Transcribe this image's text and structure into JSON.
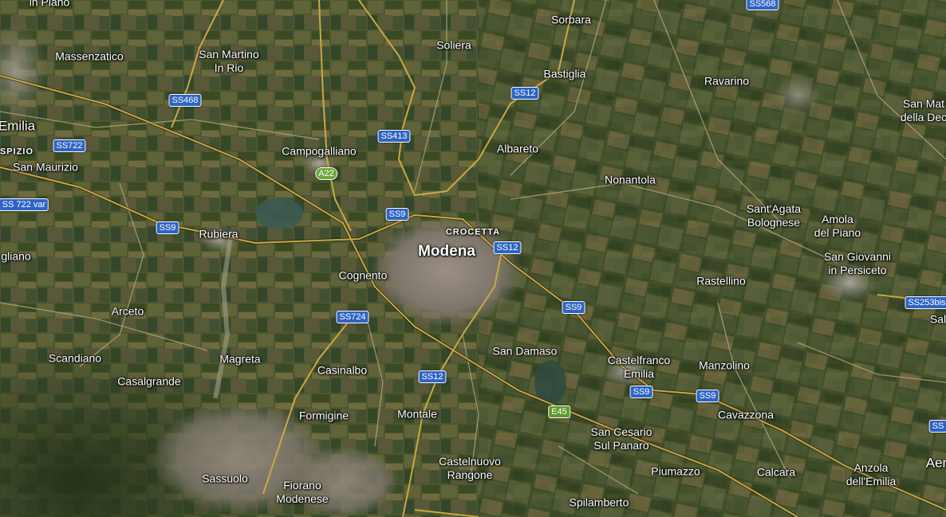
{
  "map": {
    "view": "satellite",
    "colors": {
      "field_light": "#6b6a3e",
      "field_dark": "#2e3f1f",
      "urban": "#8b8377",
      "road_primary": "#c9a844",
      "road_secondary": "#b9ad84",
      "shield_blue": "#2e64c4",
      "shield_green": "#5e9a2c",
      "label": "#ffffff"
    },
    "places": [
      {
        "id": "in-piano",
        "label": "in Piano"
      },
      {
        "id": "sorbara",
        "label": "Sorbara"
      },
      {
        "id": "massenzatico",
        "label": "Massenzatico"
      },
      {
        "id": "san-martino-in-rio",
        "label": "San Martino\nIn Rio"
      },
      {
        "id": "soliera",
        "label": "Soliera"
      },
      {
        "id": "bastiglia",
        "label": "Bastiglia"
      },
      {
        "id": "ravarino",
        "label": "Ravarino"
      },
      {
        "id": "san-matteo-della-decima",
        "label": "San Mat\ndella Dec"
      },
      {
        "id": "emilia",
        "label": "Emilia"
      },
      {
        "id": "ospizio",
        "label": "SPIZIO"
      },
      {
        "id": "campogalliano",
        "label": "Campogalliano"
      },
      {
        "id": "albareto",
        "label": "Albareto"
      },
      {
        "id": "san-maurizio",
        "label": "San Maurizio"
      },
      {
        "id": "nonantola",
        "label": "Nonantola"
      },
      {
        "id": "santagata-bolognese",
        "label": "Sant'Agata\nBolognese"
      },
      {
        "id": "amola-del-piano",
        "label": "Amola\ndel Piano"
      },
      {
        "id": "rubiera",
        "label": "Rubiera"
      },
      {
        "id": "crocetta",
        "label": "CROCETTA"
      },
      {
        "id": "modena",
        "label": "Modena"
      },
      {
        "id": "gliano",
        "label": "gliano"
      },
      {
        "id": "san-giovanni-in-persiceto",
        "label": "San Giovanni\nin Persiceto"
      },
      {
        "id": "cognento",
        "label": "Cognento"
      },
      {
        "id": "rastellino",
        "label": "Rastellino"
      },
      {
        "id": "arceto",
        "label": "Arceto"
      },
      {
        "id": "sal",
        "label": "Sal"
      },
      {
        "id": "scandiano",
        "label": "Scandiano"
      },
      {
        "id": "magreta",
        "label": "Magreta"
      },
      {
        "id": "san-damaso",
        "label": "San Damaso"
      },
      {
        "id": "castelfranco-emilia",
        "label": "Castelfranco\nEmilia"
      },
      {
        "id": "manzolino",
        "label": "Manzolino"
      },
      {
        "id": "casalgrande",
        "label": "Casalgrande"
      },
      {
        "id": "casinalbo",
        "label": "Casinalbo"
      },
      {
        "id": "formigine",
        "label": "Formigine"
      },
      {
        "id": "montale",
        "label": "Montale"
      },
      {
        "id": "cavazzona",
        "label": "Cavazzona"
      },
      {
        "id": "san-cesario-sul-panaro",
        "label": "San Cesario\nSul Panaro"
      },
      {
        "id": "castelnuovo-rangone",
        "label": "Castelnuovo\nRangone"
      },
      {
        "id": "piumazzo",
        "label": "Piumazzo"
      },
      {
        "id": "calcara",
        "label": "Calcara"
      },
      {
        "id": "anzola-dellemilia",
        "label": "Anzola\ndell'Emilia"
      },
      {
        "id": "aer",
        "label": "Aer"
      },
      {
        "id": "sassuolo",
        "label": "Sassuolo"
      },
      {
        "id": "fiorano-modenese",
        "label": "Fiorano\nModenese"
      },
      {
        "id": "spilamberto",
        "label": "Spilamberto"
      }
    ],
    "shields": [
      {
        "id": "ss568",
        "label": "SS568"
      },
      {
        "id": "ss468",
        "label": "SS468"
      },
      {
        "id": "ss12-north",
        "label": "SS12"
      },
      {
        "id": "ss413",
        "label": "SS413"
      },
      {
        "id": "ss722",
        "label": "SS722"
      },
      {
        "id": "a22",
        "label": "A22"
      },
      {
        "id": "ss722var",
        "label": "SS 722 var"
      },
      {
        "id": "ss9-modena",
        "label": "SS9"
      },
      {
        "id": "ss9-rubiera",
        "label": "SS9"
      },
      {
        "id": "ss12-modena",
        "label": "SS12"
      },
      {
        "id": "ss9-east",
        "label": "SS9"
      },
      {
        "id": "ss724",
        "label": "SS724"
      },
      {
        "id": "ss253bis",
        "label": "SS253bis"
      },
      {
        "id": "ss12-south",
        "label": "SS12"
      },
      {
        "id": "ss9-castelfranco",
        "label": "SS9"
      },
      {
        "id": "ss9-manzolino",
        "label": "SS9"
      },
      {
        "id": "e45",
        "label": "E45"
      },
      {
        "id": "ss-edge",
        "label": "SS"
      }
    ]
  }
}
